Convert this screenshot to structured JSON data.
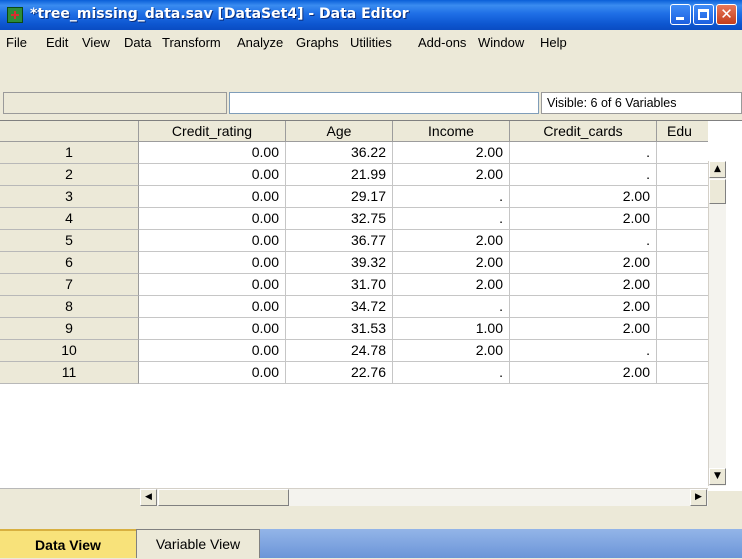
{
  "window": {
    "title": "*tree_missing_data.sav [DataSet4] - Data Editor"
  },
  "menubar": {
    "items": [
      "File",
      "Edit",
      "View",
      "Data",
      "Transform",
      "Analyze",
      "Graphs",
      "Utilities",
      "Add-ons",
      "Window",
      "Help"
    ]
  },
  "editor": {
    "cell_name": "",
    "cell_value": "",
    "visible_text": "Visible: 6 of 6 Variables"
  },
  "grid": {
    "columns": [
      "Credit_rating",
      "Age",
      "Income",
      "Credit_cards",
      "Edu"
    ],
    "rows": [
      {
        "n": "1",
        "cells": [
          "0.00",
          "36.22",
          "2.00",
          "."
        ]
      },
      {
        "n": "2",
        "cells": [
          "0.00",
          "21.99",
          "2.00",
          "."
        ]
      },
      {
        "n": "3",
        "cells": [
          "0.00",
          "29.17",
          ".",
          "2.00"
        ]
      },
      {
        "n": "4",
        "cells": [
          "0.00",
          "32.75",
          ".",
          "2.00"
        ]
      },
      {
        "n": "5",
        "cells": [
          "0.00",
          "36.77",
          "2.00",
          "."
        ]
      },
      {
        "n": "6",
        "cells": [
          "0.00",
          "39.32",
          "2.00",
          "2.00"
        ]
      },
      {
        "n": "7",
        "cells": [
          "0.00",
          "31.70",
          "2.00",
          "2.00"
        ]
      },
      {
        "n": "8",
        "cells": [
          "0.00",
          "34.72",
          ".",
          "2.00"
        ]
      },
      {
        "n": "9",
        "cells": [
          "0.00",
          "31.53",
          "1.00",
          "2.00"
        ]
      },
      {
        "n": "10",
        "cells": [
          "0.00",
          "24.78",
          "2.00",
          "."
        ]
      },
      {
        "n": "11",
        "cells": [
          "0.00",
          "22.76",
          ".",
          "2.00"
        ]
      }
    ]
  },
  "tabs": {
    "data_view": "Data View",
    "variable_view": "Variable View"
  },
  "icons": {
    "app": "spss-grid-icon",
    "minimize": "minimize-icon",
    "maximize": "maximize-icon",
    "close": "close-icon",
    "scroll_up": "arrow-up-icon",
    "scroll_down": "arrow-down-icon",
    "scroll_left": "arrow-left-icon",
    "scroll_right": "arrow-right-icon"
  },
  "colors": {
    "titlebar": "#1f6fe6",
    "active_tab": "#f8e27a",
    "tab_strip": "#6c95d8"
  }
}
